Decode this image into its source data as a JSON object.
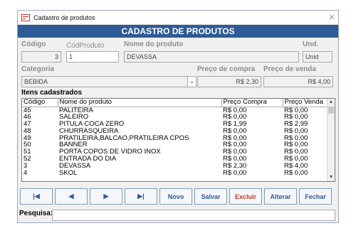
{
  "window": {
    "title": "Cadastro de produtos"
  },
  "header": {
    "title": "CADASTRO DE PRODUTOS"
  },
  "form": {
    "codigo_label": "Código",
    "codigo_value": "3",
    "codproduto_label": "CódProduto",
    "codproduto_value": "1",
    "nome_label": "Nome do produto",
    "nome_value": "DEVASSA",
    "und_label": "Und.",
    "und_value": "Unid",
    "categoria_label": "Categoria",
    "categoria_value": "BEBIDA",
    "preco_compra_label": "Preço de compra",
    "preco_compra_value": "R$ 2,30",
    "preco_venda_label": "Preço de venda",
    "preco_venda_value": "R$ 4,00"
  },
  "list": {
    "title": "Itens cadastrados",
    "columns": [
      "Código",
      "Nome do produto",
      "Preço Compra",
      "Preço Venda"
    ],
    "rows": [
      [
        "45",
        "PALITEIRA",
        "R$ 0,00",
        "R$ 0,00"
      ],
      [
        "46",
        "SALEIRO",
        "R$ 0,00",
        "R$ 0,00"
      ],
      [
        "47",
        "PITULA COCA ZERO",
        "R$ 1,99",
        "R$ 2,99"
      ],
      [
        "48",
        "CHURRASQUEIRA",
        "R$ 0,00",
        "R$ 0,00"
      ],
      [
        "49",
        "PRATILEIRA,BALCAO,PRATILEIRA CPOS",
        "R$ 0,00",
        "R$ 0,00"
      ],
      [
        "50",
        "BANNER",
        "R$ 0,00",
        "R$ 0,00"
      ],
      [
        "51",
        "PORTA COPOS DE VIDRO INOX",
        "R$ 0,00",
        "R$ 0,00"
      ],
      [
        "52",
        "ENTRADA DO DIA",
        "R$ 0,00",
        "R$ 0,00"
      ],
      [
        "3",
        "DEVASSA",
        "R$ 2,30",
        "R$ 4,00"
      ],
      [
        "4",
        "SKOL",
        "R$ 0,00",
        "R$ 0,00"
      ]
    ]
  },
  "buttons": {
    "first": "|◀",
    "prev": "◀",
    "next": "▶",
    "last": "▶|",
    "novo": "Novo",
    "salvar": "Salvar",
    "excluir": "Excluir",
    "alterar": "Alterar",
    "fechar": "Fechar"
  },
  "search": {
    "label": "Pesquisa:",
    "value": ""
  },
  "colors": {
    "header": "#2e5b95",
    "button_text": "#2e5b95",
    "delete_text": "#c0392b"
  }
}
